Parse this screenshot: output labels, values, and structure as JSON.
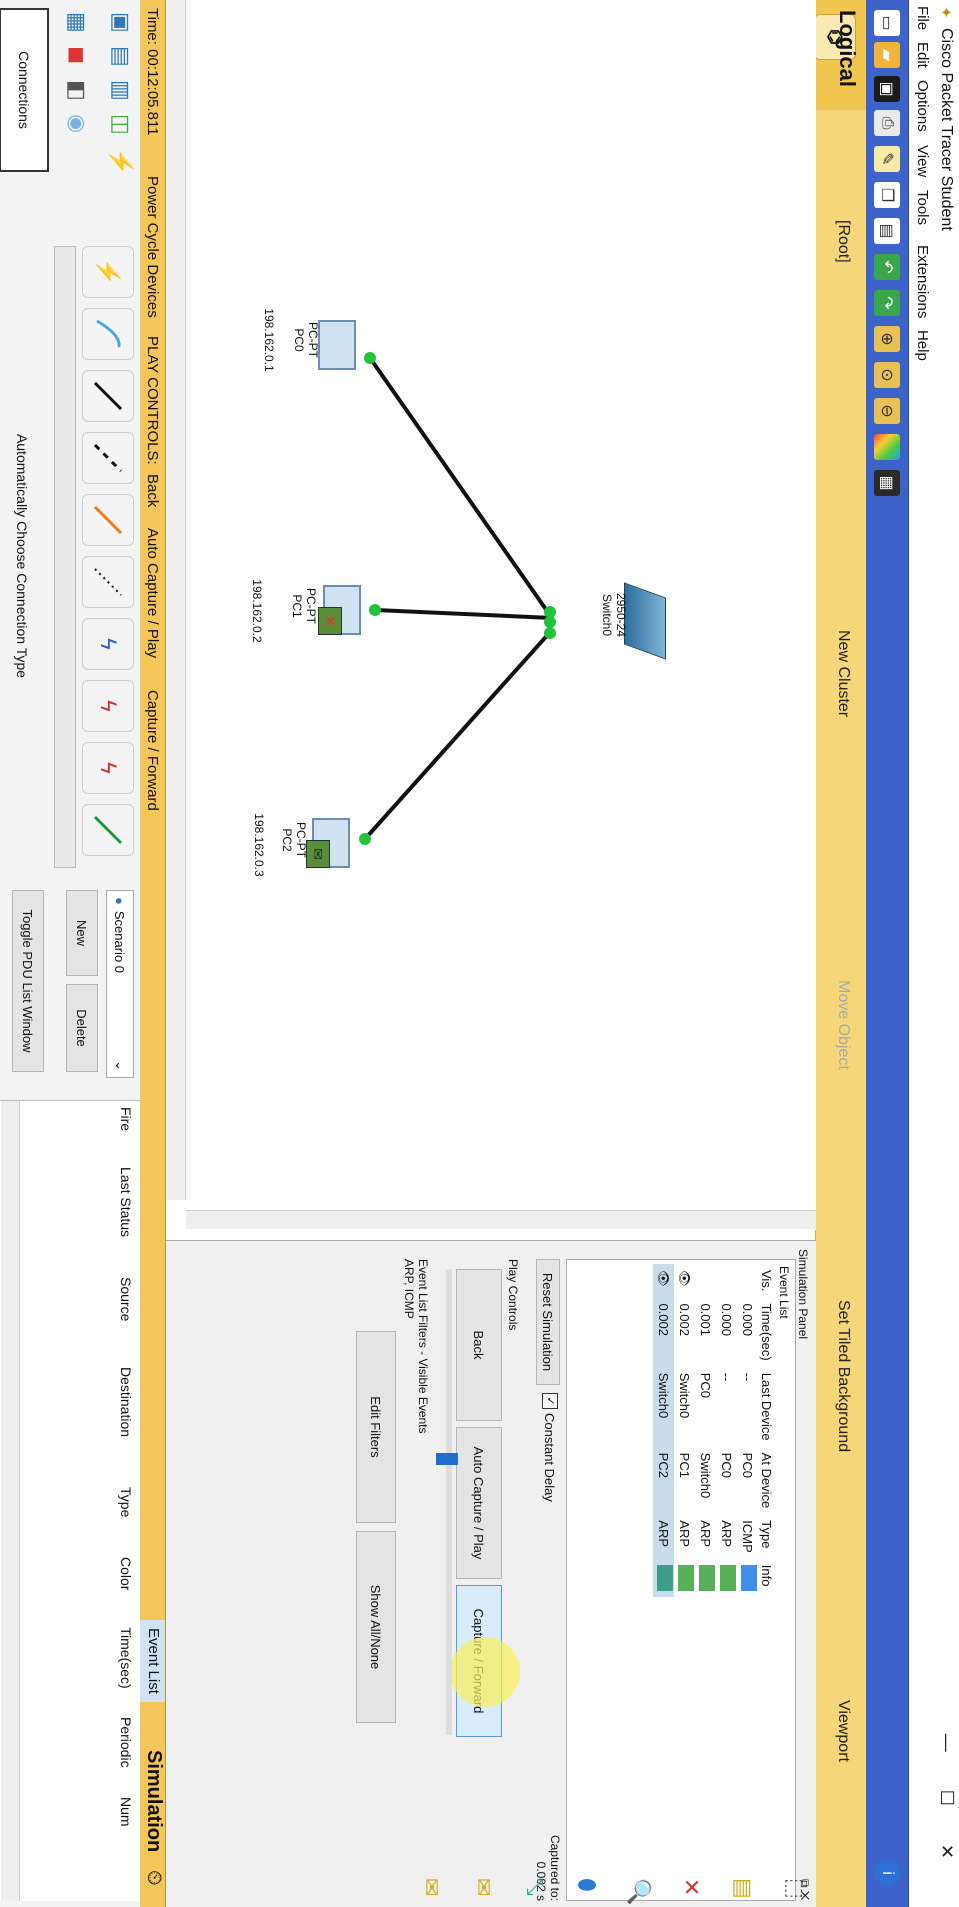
{
  "window": {
    "title": "Cisco Packet Tracer Student"
  },
  "menu": [
    "File",
    "Edit",
    "Options",
    "View",
    "Tools",
    "Extensions",
    "Help"
  ],
  "toolbar_icons": [
    "new-icon",
    "open-icon",
    "save-icon",
    "print-icon",
    "activity-wizard-icon",
    "copy-icon",
    "paste-icon",
    "undo-icon",
    "redo-icon",
    "zoom-in-icon",
    "zoom-reset-icon",
    "zoom-out-icon",
    "palette-icon",
    "device-template-icon",
    "info-icon"
  ],
  "nav": {
    "logical": "Logical",
    "root": "[Root]",
    "new_cluster": "New Cluster",
    "move_object": "Move Object",
    "tiled_bg": "Set Tiled Background",
    "viewport": "Viewport"
  },
  "devices": {
    "switch": {
      "model": "2950-24",
      "name": "Switch0"
    },
    "pc0": {
      "model": "PC-PT",
      "name": "PC0",
      "ip": "198.162.0.1"
    },
    "pc1": {
      "model": "PC-PT",
      "name": "PC1",
      "ip": "198.162.0.2"
    },
    "pc2": {
      "model": "PC-PT",
      "name": "PC2",
      "ip": "198.162.0.3"
    }
  },
  "sim_panel": {
    "title": "Simulation Panel",
    "event_list_label": "Event List",
    "columns": [
      "Vis.",
      "Time(sec)",
      "Last Device",
      "At Device",
      "Type",
      "Info"
    ],
    "events": [
      {
        "time": "0.000",
        "last": "--",
        "at": "PC0",
        "type": "ICMP",
        "color": "#3f8fe8"
      },
      {
        "time": "0.000",
        "last": "--",
        "at": "PC0",
        "type": "ARP",
        "color": "#5aaf5a"
      },
      {
        "time": "0.001",
        "last": "PC0",
        "at": "Switch0",
        "type": "ARP",
        "color": "#5aaf5a"
      },
      {
        "time": "0.002",
        "last": "Switch0",
        "at": "PC1",
        "type": "ARP",
        "color": "#5aaf5a"
      },
      {
        "time": "0.002",
        "last": "Switch0",
        "at": "PC2",
        "type": "ARP",
        "color": "#3f9e8a"
      }
    ],
    "reset": "Reset Simulation",
    "constant_delay": "Constant Delay",
    "captured_to_label": "Captured to:",
    "captured_to_value": "0.002 s",
    "play_controls": "Play Controls",
    "back": "Back",
    "auto_capture": "Auto Capture / Play",
    "capture_forward": "Capture / Forward",
    "filters_label": "Event List Filters - Visible Events",
    "filters_value": "ARP, ICMP",
    "edit_filters": "Edit Filters",
    "show_all": "Show All/None"
  },
  "bottombar": {
    "time": "Time: 00:12:05.811",
    "power_cycle": "Power Cycle Devices",
    "play_controls": "PLAY CONTROLS:",
    "back": "Back",
    "auto_capture": "Auto Capture / Play",
    "capture_forward": "Capture / Forward",
    "event_list": "Event List",
    "simulation": "Simulation"
  },
  "bottom": {
    "connections_label": "Connections",
    "auto_connection": "Automatically Choose Connection Type",
    "scenario": "Scenario 0",
    "new": "New",
    "delete": "Delete",
    "toggle_pdu": "Toggle PDU List Window",
    "pdu_columns": [
      "Fire",
      "Last Status",
      "Source",
      "Destination",
      "Type",
      "Color",
      "Time(sec)",
      "Periodic",
      "Num"
    ]
  }
}
